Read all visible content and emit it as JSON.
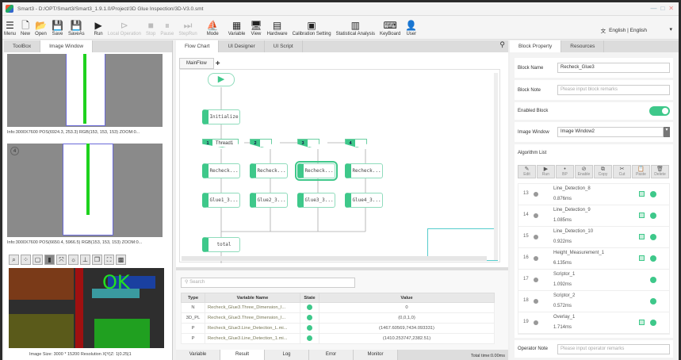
{
  "window": {
    "title": "Smart3 - D:/OPT/Smart3/Smart3_1.9.1.0/Project/3D Glue Inspection/3D-V3.0.smt",
    "controls": [
      "—",
      "□",
      "✕"
    ]
  },
  "toolbar": [
    {
      "label": "Menu",
      "icon": "☰",
      "enabled": true
    },
    {
      "label": "New",
      "icon": "🗋",
      "enabled": true
    },
    {
      "label": "Open",
      "icon": "📂",
      "enabled": true
    },
    {
      "label": "Save",
      "icon": "💾",
      "enabled": true
    },
    {
      "label": "SaveAs",
      "icon": "💾",
      "enabled": true
    },
    {
      "label": "Run",
      "icon": "▶",
      "enabled": true
    },
    {
      "label": "Local Operation",
      "icon": "⊳",
      "enabled": false
    },
    {
      "label": "Stop",
      "icon": "■",
      "enabled": false
    },
    {
      "label": "Pause",
      "icon": "⏸",
      "enabled": false
    },
    {
      "label": "StepRun",
      "icon": "⏭",
      "enabled": false
    },
    {
      "label": "Mode",
      "icon": "⛵",
      "enabled": true
    },
    {
      "label": "Variable",
      "icon": "▦",
      "enabled": true
    },
    {
      "label": "View",
      "icon": "🖥",
      "enabled": true
    },
    {
      "label": "Hardware",
      "icon": "▤",
      "enabled": true
    },
    {
      "label": "Calibration Setting",
      "icon": "▣",
      "enabled": true
    },
    {
      "label": "Statistical Analysis",
      "icon": "▥",
      "enabled": true
    },
    {
      "label": "KeyBoard",
      "icon": "⌨",
      "enabled": true
    },
    {
      "label": "User",
      "icon": "👤",
      "enabled": true
    }
  ],
  "language": "English | English",
  "left": {
    "tabs": [
      "ToolBox",
      "Image Window"
    ],
    "active_tab": 1,
    "info1": "Info:3000X7600 POS(6924.3, 253.3) RGB(153, 153, 153) ZOOM:0...",
    "info2": "Info:3000X7600 POS(6650.4, 5966.5) RGB(153, 153, 153) ZOOM:0...",
    "window_badge": "4",
    "result_text": "OK",
    "image_size": "Image Size: 3000 * 15200    Resolution X|Y|Z: 1|0.25|1"
  },
  "center": {
    "tabs": [
      "Flow Chart",
      "UI Designer",
      "UI Script"
    ],
    "active_tab": 0,
    "flow_tab": "MainFlow",
    "add": "+",
    "flow": {
      "init": "Initialize",
      "threads": [
        "Thread1",
        "",
        "",
        ""
      ],
      "thread_nums": [
        "1",
        "2",
        "3",
        "4"
      ],
      "recheck": [
        "Recheck...",
        "Recheck...",
        "Recheck...",
        "Recheck..."
      ],
      "glue": [
        "Glue1_3...",
        "Glue2_3...",
        "Glue3_3...",
        "Glue4_3..."
      ],
      "total": "total"
    },
    "search_placeholder": "Search",
    "columns": [
      "Type",
      "Variable Name",
      "State",
      "Value"
    ],
    "rows": [
      {
        "type": "N",
        "name": "Recheck_Glue3.Three_Dimension_I...",
        "value": "0"
      },
      {
        "type": "3D_PL",
        "name": "Recheck_Glue3.Three_Dimension_I...",
        "value": "(0,0,1,0)"
      },
      {
        "type": "P",
        "name": "Recheck_Glue3.Line_Detection_L.mi...",
        "value": "(1467.60569,7434.093331)"
      },
      {
        "type": "P",
        "name": "Recheck_Glue3.Line_Detection_1.mi...",
        "value": "(1410.253747,2382.51)"
      }
    ],
    "bottom_tabs": [
      "Variable",
      "Result",
      "Log",
      "Error",
      "Monitor"
    ],
    "active_bottom": 1,
    "total_time": "Total time:0.00ms"
  },
  "right": {
    "tabs": [
      "Block Property",
      "Resources"
    ],
    "active_tab": 0,
    "block_name_label": "Block Name",
    "block_name": "Recheck_Glue3",
    "block_note_label": "Block Note",
    "block_note_placeholder": "Please input block remarks",
    "enabled_label": "Enabled Block",
    "enabled": true,
    "image_window_label": "Image Window",
    "image_window": "Image Window2",
    "algo_label": "Algorithm List",
    "algo_buttons": [
      {
        "label": "Edit",
        "icon": "✎"
      },
      {
        "label": "Run",
        "icon": "▶"
      },
      {
        "label": "BP",
        "icon": "•"
      },
      {
        "label": "Enable",
        "icon": "⊘"
      },
      {
        "label": "Copy",
        "icon": "⧉"
      },
      {
        "label": "Cut",
        "icon": "✂"
      },
      {
        "label": "Paste",
        "icon": "📋"
      },
      {
        "label": "Delete",
        "icon": "🗑"
      }
    ],
    "algorithms": [
      {
        "idx": "13",
        "name": "Line_Detection_8",
        "time": "0.876ms",
        "image": true
      },
      {
        "idx": "14",
        "name": "Line_Detection_9",
        "time": "1.085ms",
        "image": true
      },
      {
        "idx": "15",
        "name": "Line_Detection_10",
        "time": "0.922ms",
        "image": true
      },
      {
        "idx": "16",
        "name": "Height_Measurement_1",
        "time": "6.135ms",
        "image": true
      },
      {
        "idx": "17",
        "name": "Scriptor_1",
        "time": "1.092ms",
        "image": false
      },
      {
        "idx": "18",
        "name": "Scriptor_2",
        "time": "0.572ms",
        "image": false
      },
      {
        "idx": "19",
        "name": "Overlay_1",
        "time": "1.714ms",
        "image": true
      }
    ],
    "operator_note_label": "Operator Note",
    "operator_note_placeholder": "Please input operator remarks"
  },
  "colors": {
    "accent": "#3ec88a",
    "ok": "#22e022"
  }
}
